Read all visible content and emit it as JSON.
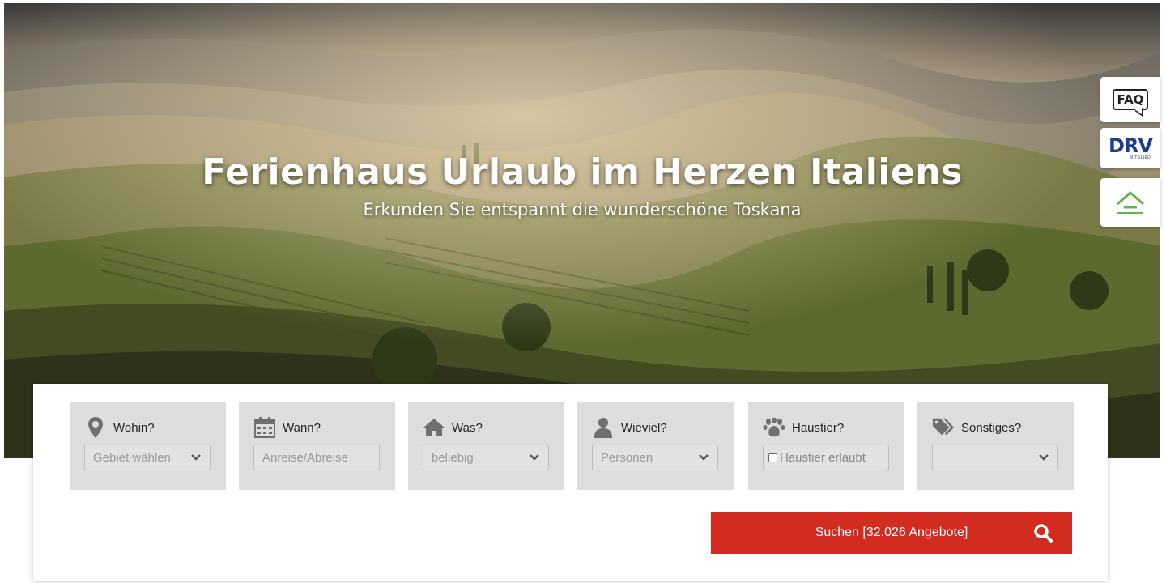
{
  "hero": {
    "title": "Ferienhaus Urlaub im Herzen Italiens",
    "subtitle": "Erkunden Sie entspannt die wunderschöne Toskana"
  },
  "side_badges": {
    "faq_label": "FAQ",
    "drv_label": "DRV",
    "drv_sublabel": "MITGLIED"
  },
  "search": {
    "fields": [
      {
        "label": "Wohin?",
        "icon": "map-pin-icon",
        "control": "select",
        "value": "Gebiet wählen"
      },
      {
        "label": "Wann?",
        "icon": "calendar-icon",
        "control": "input",
        "placeholder": "Anreise/Abreise"
      },
      {
        "label": "Was?",
        "icon": "home-icon",
        "control": "select",
        "value": "beliebig"
      },
      {
        "label": "Wieviel?",
        "icon": "user-icon",
        "control": "select",
        "value": "Personen"
      },
      {
        "label": "Haustier?",
        "icon": "paw-icon",
        "control": "checkbox",
        "value": "Haustier erlaubt",
        "checked": false
      },
      {
        "label": "Sonstiges?",
        "icon": "tags-icon",
        "control": "select",
        "value": ""
      }
    ],
    "button_label": "Suchen [32.026 Angebote]",
    "button_icon": "search-icon"
  },
  "colors": {
    "accent": "#d22b1f",
    "field_bg": "#dddddd",
    "drv_blue": "#1d3f8a",
    "dfv_green": "#6ab04c"
  }
}
